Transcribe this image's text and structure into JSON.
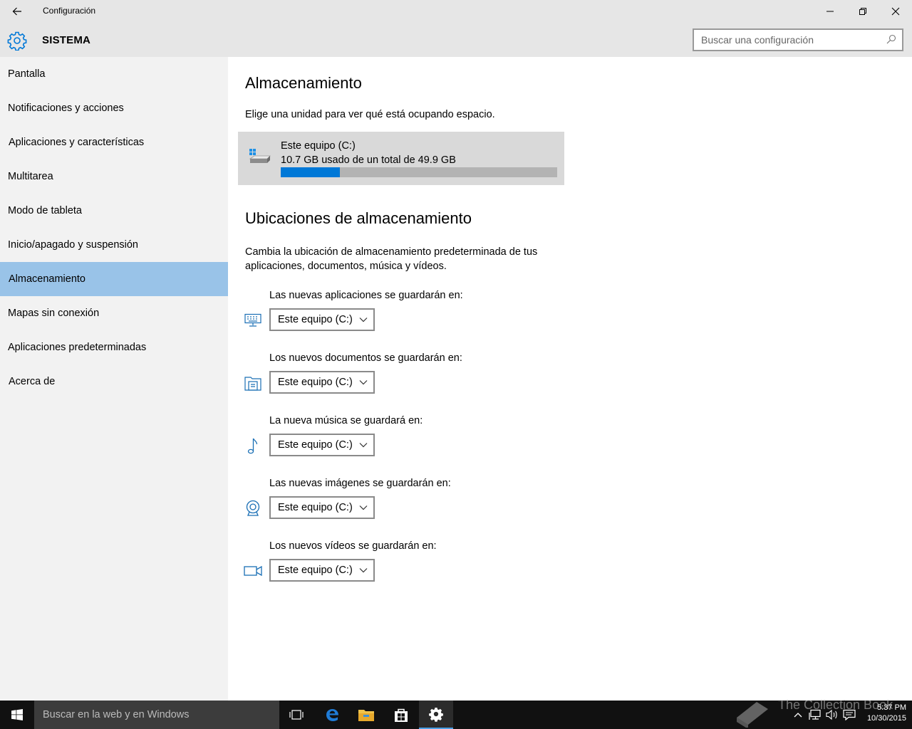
{
  "titlebar": {
    "app_title": "Configuración"
  },
  "header": {
    "section_title": "SISTEMA",
    "search_placeholder": "Buscar una configuración"
  },
  "sidebar": {
    "items": [
      {
        "label": "Pantalla",
        "active": false
      },
      {
        "label": "Notificaciones y acciones",
        "active": false
      },
      {
        "label": "Aplicaciones y características",
        "active": false
      },
      {
        "label": "Multitarea",
        "active": false
      },
      {
        "label": "Modo de tableta",
        "active": false
      },
      {
        "label": "Inicio/apagado y suspensión",
        "active": false
      },
      {
        "label": "Almacenamiento",
        "active": true
      },
      {
        "label": "Mapas sin conexión",
        "active": false
      },
      {
        "label": "Aplicaciones predeterminadas",
        "active": false
      },
      {
        "label": "Acerca de",
        "active": false
      }
    ]
  },
  "main": {
    "title": "Almacenamiento",
    "description": "Elige una unidad para ver qué está ocupando espacio.",
    "drive": {
      "name": "Este equipo (C:)",
      "usage_text": "10.7 GB usado de un total de 49.9 GB",
      "used_gb": 10.7,
      "total_gb": 49.9
    },
    "locations_title": "Ubicaciones de almacenamiento",
    "locations_description": "Cambia la ubicación de almacenamiento predeterminada de tus aplicaciones, documentos, música y vídeos.",
    "locations": [
      {
        "label": "Las nuevas aplicaciones se guardarán en:",
        "value": "Este equipo (C:)",
        "icon": "monitor-apps-icon"
      },
      {
        "label": "Los nuevos documentos se guardarán en:",
        "value": "Este equipo (C:)",
        "icon": "documents-icon"
      },
      {
        "label": "La nueva música se guardará en:",
        "value": "Este equipo (C:)",
        "icon": "music-note-icon"
      },
      {
        "label": "Las nuevas imágenes se guardarán en:",
        "value": "Este equipo (C:)",
        "icon": "webcam-icon"
      },
      {
        "label": "Los nuevos vídeos se guardarán en:",
        "value": "Este equipo (C:)",
        "icon": "video-camera-icon"
      }
    ]
  },
  "taskbar": {
    "search_placeholder": "Buscar en la web y en Windows",
    "time": "5:37 PM",
    "date": "10/30/2015",
    "watermark": "The Collection Book"
  },
  "colors": {
    "accent": "#0078d7",
    "active_nav": "#99c3e8",
    "chrome": "#e6e6e6",
    "sidebar": "#f2f2f2",
    "taskbar": "#111111"
  }
}
